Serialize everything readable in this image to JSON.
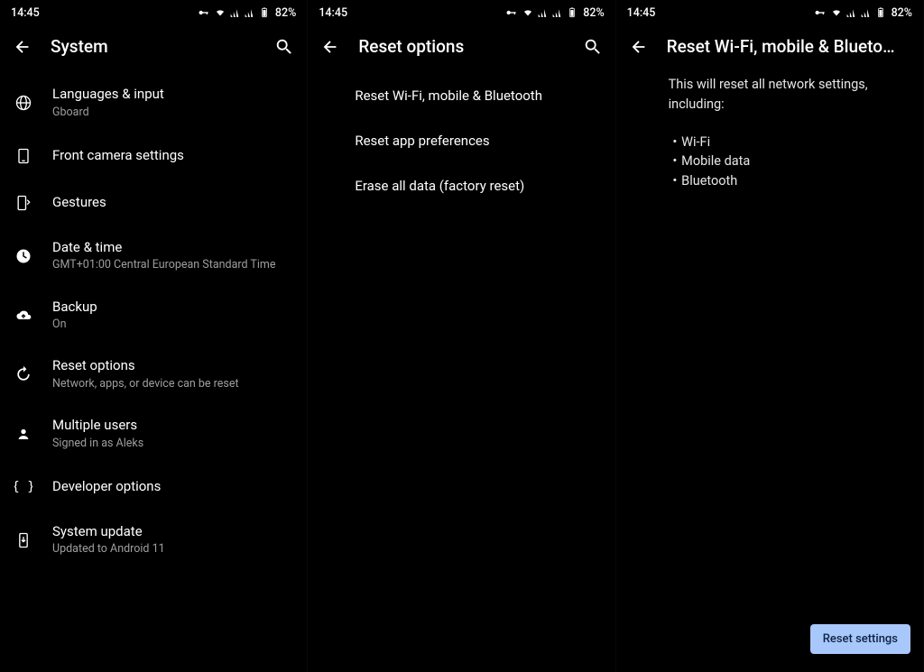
{
  "status": {
    "time": "14:45",
    "battery": "82%"
  },
  "pane1": {
    "title": "System",
    "items": [
      {
        "icon": "globe",
        "title": "Languages & input",
        "sub": "Gboard"
      },
      {
        "icon": "tablet",
        "title": "Front camera settings",
        "sub": ""
      },
      {
        "icon": "swipe",
        "title": "Gestures",
        "sub": ""
      },
      {
        "icon": "clock",
        "title": "Date & time",
        "sub": "GMT+01:00 Central European Standard Time"
      },
      {
        "icon": "cloud-up",
        "title": "Backup",
        "sub": "On"
      },
      {
        "icon": "restore",
        "title": "Reset options",
        "sub": "Network, apps, or device can be reset"
      },
      {
        "icon": "person",
        "title": "Multiple users",
        "sub": "Signed in as Aleks"
      },
      {
        "icon": "braces",
        "title": "Developer options",
        "sub": ""
      },
      {
        "icon": "update",
        "title": "System update",
        "sub": "Updated to Android 11"
      }
    ]
  },
  "pane2": {
    "title": "Reset options",
    "items": [
      "Reset Wi-Fi, mobile & Bluetooth",
      "Reset app preferences",
      "Erase all data (factory reset)"
    ]
  },
  "pane3": {
    "title": "Reset Wi-Fi, mobile & Blueto…",
    "intro": "This will reset all network settings, including:",
    "bullets": [
      "Wi-Fi",
      "Mobile data",
      "Bluetooth"
    ],
    "button": "Reset settings"
  }
}
